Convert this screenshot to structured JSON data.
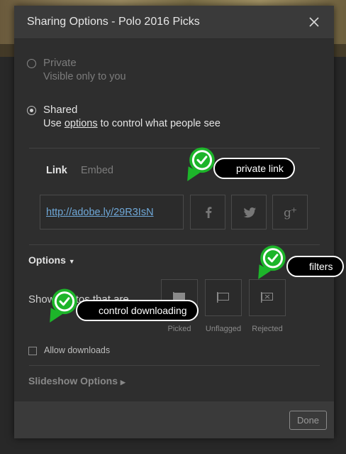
{
  "dialog": {
    "title": "Sharing Options - Polo 2016 Picks",
    "close_icon": "close-icon"
  },
  "privacy": {
    "private_label": "Private",
    "private_sub": "Visible only to you",
    "shared_label": "Shared",
    "shared_sub_prefix": "Use ",
    "shared_sub_link": "options",
    "shared_sub_suffix": " to control what people see",
    "selected": "Shared"
  },
  "tabs": {
    "link": "Link",
    "embed": "Embed",
    "active": "Link"
  },
  "share": {
    "url": "http://adobe.ly/29R3IsN",
    "social": [
      "facebook-icon",
      "twitter-icon",
      "google-plus-icon"
    ]
  },
  "options": {
    "header": "Options",
    "show_label": "Show photos that are",
    "filters": [
      {
        "label": "Picked",
        "icon": "pick-flag-icon"
      },
      {
        "label": "Unflagged",
        "icon": "unflagged-icon"
      },
      {
        "label": "Rejected",
        "icon": "reject-flag-icon"
      }
    ],
    "allow_downloads": "Allow downloads"
  },
  "slideshow": {
    "label": "Slideshow Options"
  },
  "footer": {
    "done": "Done"
  },
  "annotations": {
    "private_link": "private link",
    "filters": "filters",
    "control_downloading": "control downloading"
  },
  "colors": {
    "accent_link": "#6fa8d8",
    "callout_green": "#1db52a"
  }
}
